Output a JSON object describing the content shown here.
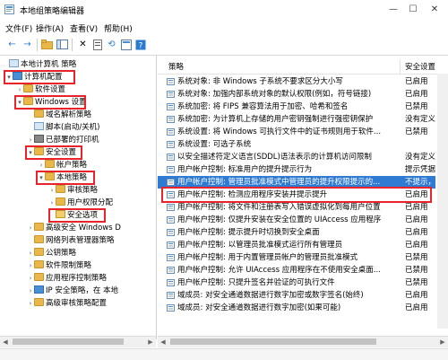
{
  "window": {
    "title": "本地组策略编辑器",
    "minimize": "—",
    "maximize": "☐",
    "close": "✕"
  },
  "menu": [
    "文件(F)",
    "操作(A)",
    "查看(V)",
    "帮助(H)"
  ],
  "toolbar": {
    "back": "←",
    "forward": "→",
    "up": "↑",
    "delete": "✕",
    "refresh": "⟲",
    "export": "⇪",
    "help": "?",
    "filter": "▼"
  },
  "tree": {
    "items": [
      {
        "label": "本地计算机 策略",
        "expander": "",
        "icon": "pc-icon",
        "highlight": false
      },
      {
        "label": "计算机配置",
        "expander": "▾",
        "icon": "pc-icon",
        "highlight": true
      },
      {
        "label": "软件设置",
        "expander": "›",
        "icon": "folder-icon",
        "highlight": false
      },
      {
        "label": "Windows 设置",
        "expander": "▾",
        "icon": "folder-icon",
        "highlight": true
      },
      {
        "label": "域名解析策略",
        "expander": "",
        "icon": "doc-icon",
        "highlight": false
      },
      {
        "label": "脚本(启动/关机)",
        "expander": "",
        "icon": "doc-icon",
        "highlight": false
      },
      {
        "label": "已部署的打印机",
        "expander": "›",
        "icon": "printer-icon",
        "highlight": false
      },
      {
        "label": "安全设置",
        "expander": "▾",
        "icon": "folder-icon",
        "highlight": true
      },
      {
        "label": "帐户策略",
        "expander": "›",
        "icon": "folder-icon",
        "highlight": false
      },
      {
        "label": "本地策略",
        "expander": "▾",
        "icon": "folder-icon",
        "highlight": true
      },
      {
        "label": "审核策略",
        "expander": "›",
        "icon": "folder-icon",
        "highlight": false
      },
      {
        "label": "用户权限分配",
        "expander": "›",
        "icon": "folder-icon",
        "highlight": false
      },
      {
        "label": "安全选项",
        "expander": "",
        "icon": "folder-open-icon",
        "highlight": true
      },
      {
        "label": "高级安全 Windows D",
        "expander": "›",
        "icon": "folder-icon",
        "highlight": false
      },
      {
        "label": "网络列表管理器策略",
        "expander": "",
        "icon": "folder-icon",
        "highlight": false
      },
      {
        "label": "公钥策略",
        "expander": "›",
        "icon": "folder-icon",
        "highlight": false
      },
      {
        "label": "软件限制策略",
        "expander": "›",
        "icon": "folder-icon",
        "highlight": false
      },
      {
        "label": "应用程序控制策略",
        "expander": "›",
        "icon": "folder-icon",
        "highlight": false
      },
      {
        "label": "IP 安全策略，在 本地",
        "expander": "›",
        "icon": "shield-icon",
        "highlight": false
      },
      {
        "label": "高级审核策略配置",
        "expander": "›",
        "icon": "folder-icon",
        "highlight": false
      }
    ]
  },
  "list": {
    "columns": {
      "policy": "策略",
      "setting": "安全设置"
    },
    "rows": [
      {
        "name": "系统对象: 非 Windows 子系统不要求区分大小写",
        "setting": "已启用",
        "selected": false
      },
      {
        "name": "系统对象: 加强内部系统对象的默认权限(例如，符号链接)",
        "setting": "已启用",
        "selected": false
      },
      {
        "name": "系统加密: 将 FIPS 兼容算法用于加密、哈希和签名",
        "setting": "已禁用",
        "selected": false
      },
      {
        "name": "系统加密: 为计算机上存储的用户密钥强制进行强密钥保护",
        "setting": "没有定义",
        "selected": false
      },
      {
        "name": "系统设置: 将 Windows 可执行文件中的证书规则用于软件...",
        "setting": "已禁用",
        "selected": false
      },
      {
        "name": "系统设置: 可选子系统",
        "setting": "",
        "selected": false
      },
      {
        "name": "以安全描述符定义语言(SDDL)语法表示的计算机访问限制",
        "setting": "没有定义",
        "selected": false
      },
      {
        "name": "用户帐户控制: 标准用户的提升提示行为",
        "setting": "提示凭据",
        "selected": false
      },
      {
        "name": "用户帐户控制: 管理员批准模式中管理员的提升权限提示的...",
        "setting": "不提示，",
        "selected": true
      },
      {
        "name": "用户帐户控制: 检测应用程序安装并提示提升",
        "setting": "已启用",
        "selected": false
      },
      {
        "name": "用户帐户控制: 将文件和注册表写入错误虚拟化到每用户位置",
        "setting": "已启用",
        "selected": false
      },
      {
        "name": "用户帐户控制: 仅提升安装在安全位置的 UIAccess 应用程序",
        "setting": "已启用",
        "selected": false
      },
      {
        "name": "用户帐户控制: 提示提升时切换到安全桌面",
        "setting": "已启用",
        "selected": false
      },
      {
        "name": "用户帐户控制: 以管理员批准模式运行所有管理员",
        "setting": "已启用",
        "selected": false
      },
      {
        "name": "用户帐户控制: 用于内置管理员帐户的管理员批准模式",
        "setting": "已禁用",
        "selected": false
      },
      {
        "name": "用户帐户控制: 允许 UIAccess 应用程序在不使用安全桌面...",
        "setting": "已禁用",
        "selected": false
      },
      {
        "name": "用户帐户控制: 只提升签名并验证的可执行文件",
        "setting": "已禁用",
        "selected": false
      },
      {
        "name": "域成员: 对安全通道数据进行数字加密或数字签名(始终)",
        "setting": "已启用",
        "selected": false
      },
      {
        "name": "域成员: 对安全通道数据进行数字加密(如果可能)",
        "setting": "已启用",
        "selected": false
      }
    ]
  },
  "colors": {
    "highlight_box": "#e8242a",
    "selection": "#2f7bd4"
  }
}
